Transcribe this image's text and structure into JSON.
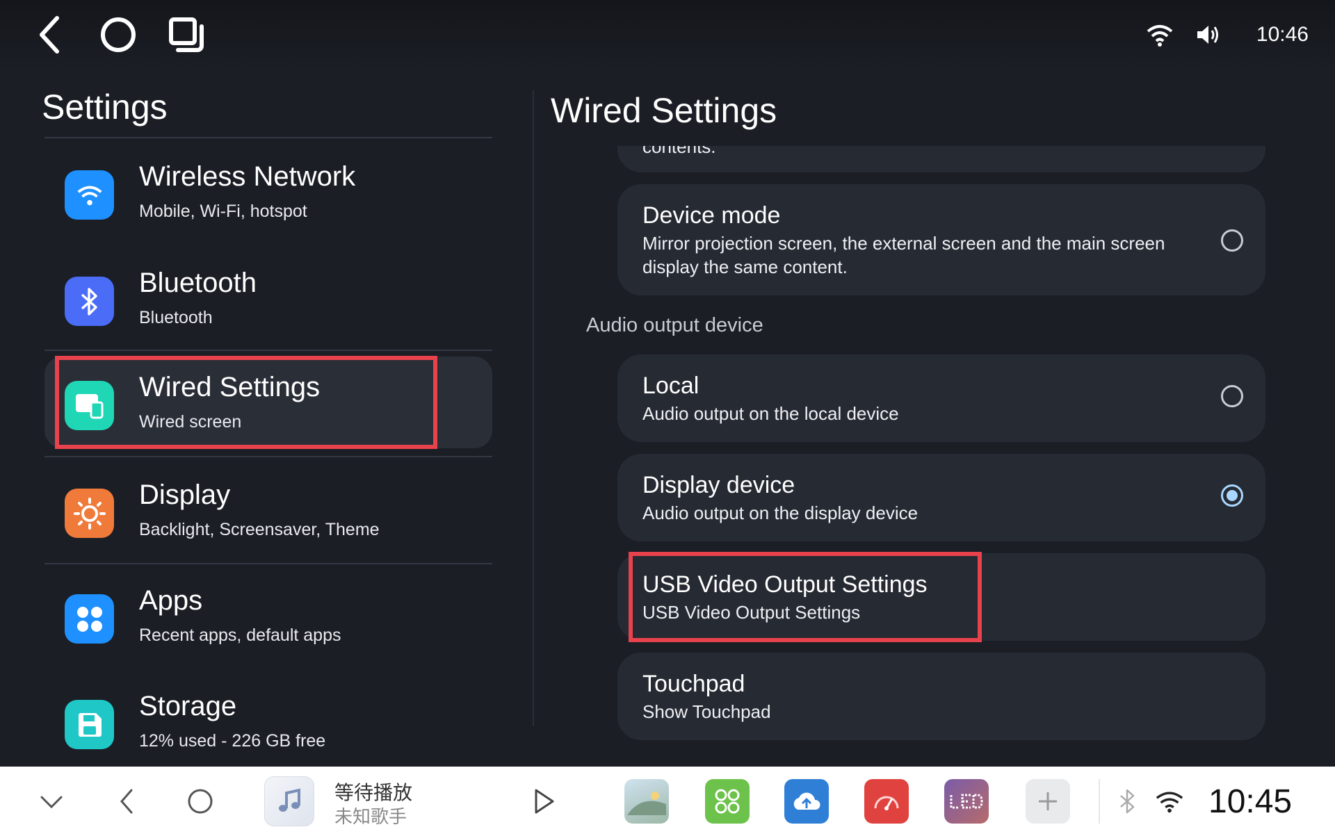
{
  "status_bar": {
    "time": "10:46"
  },
  "left": {
    "title": "Settings",
    "items": [
      {
        "title": "Wireless Network",
        "subtitle": "Mobile, Wi-Fi, hotspot",
        "icon": "wifi-icon",
        "color": "#1e90ff"
      },
      {
        "title": "Bluetooth",
        "subtitle": "Bluetooth",
        "icon": "bluetooth-icon",
        "color": "#4a6cf7"
      },
      {
        "title": "Wired Settings",
        "subtitle": "Wired screen",
        "icon": "wired-screen-icon",
        "color": "#1fd6b5"
      },
      {
        "title": "Display",
        "subtitle": "Backlight, Screensaver, Theme",
        "icon": "brightness-icon",
        "color": "#f07a3a"
      },
      {
        "title": "Apps",
        "subtitle": "Recent apps, default apps",
        "icon": "apps-grid-icon",
        "color": "#1e90ff"
      },
      {
        "title": "Storage",
        "subtitle": "12% used - 226 GB free",
        "icon": "storage-icon",
        "color": "#1fc7c7"
      }
    ]
  },
  "right": {
    "title": "Wired Settings",
    "cut_text": "contents.",
    "device_mode": {
      "title": "Device mode",
      "subtitle": "Mirror projection screen, the external screen and the main screen display the same content.",
      "selected": false
    },
    "audio_section": "Audio output device",
    "local": {
      "title": "Local",
      "subtitle": "Audio output on the local device",
      "selected": false
    },
    "display_device": {
      "title": "Display device",
      "subtitle": "Audio output on the display device",
      "selected": true
    },
    "usb": {
      "title": "USB Video Output Settings",
      "subtitle": "USB Video Output Settings"
    },
    "touchpad": {
      "title": "Touchpad",
      "subtitle": "Show Touchpad"
    }
  },
  "dock": {
    "media_title": "等待播放",
    "media_artist": "未知歌手",
    "time": "10:45",
    "apps": [
      "gallery-app-icon",
      "launcher-app-icon",
      "ota-update-app-icon",
      "speedometer-app-icon",
      "led-app-icon",
      "add-app-icon"
    ]
  },
  "accent_color": "#a9d7ff",
  "highlight_color": "#e8434d"
}
